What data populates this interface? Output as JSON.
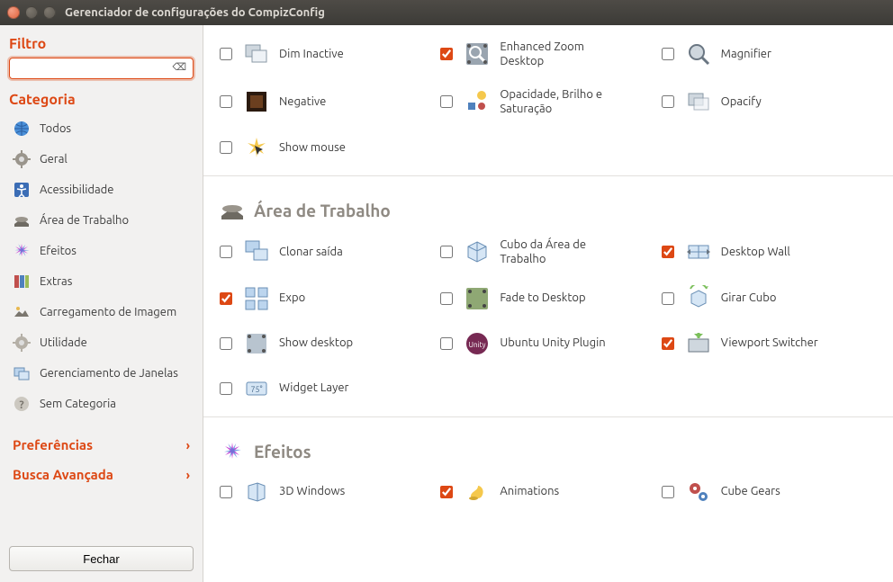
{
  "window": {
    "title": "Gerenciador de configurações do CompizConfig"
  },
  "sidebar": {
    "filter_heading": "Filtro",
    "filter_value": "",
    "filter_clear": "⌫",
    "category_heading": "Categoria",
    "categories": [
      {
        "label": "Todos",
        "icon": "globe-icon"
      },
      {
        "label": "Geral",
        "icon": "gear-icon"
      },
      {
        "label": "Acessibilidade",
        "icon": "accessibility-icon"
      },
      {
        "label": "Área de Trabalho",
        "icon": "desktop-icon"
      },
      {
        "label": "Efeitos",
        "icon": "effects-icon"
      },
      {
        "label": "Extras",
        "icon": "extras-icon"
      },
      {
        "label": "Carregamento de Imagem",
        "icon": "image-load-icon"
      },
      {
        "label": "Utilidade",
        "icon": "utility-icon"
      },
      {
        "label": "Gerenciamento de Janelas",
        "icon": "window-mgmt-icon"
      },
      {
        "label": "Sem Categoria",
        "icon": "uncategorized-icon"
      }
    ],
    "preferences": "Preferências",
    "advanced_search": "Busca Avançada",
    "close_button": "Fechar"
  },
  "sections": [
    {
      "title": null,
      "plugins": [
        {
          "label": "Dim Inactive",
          "checked": false,
          "icon": "dim-icon"
        },
        {
          "label": "Enhanced Zoom Desktop",
          "checked": true,
          "icon": "zoom-desktop-icon"
        },
        {
          "label": "Magnifier",
          "checked": false,
          "icon": "magnifier-icon"
        },
        {
          "label": "Negative",
          "checked": false,
          "icon": "negative-icon"
        },
        {
          "label": "Opacidade, Brilho e Saturação",
          "checked": false,
          "icon": "obs-icon"
        },
        {
          "label": "Opacify",
          "checked": false,
          "icon": "opacify-icon"
        },
        {
          "label": "Show mouse",
          "checked": false,
          "icon": "show-mouse-icon"
        }
      ]
    },
    {
      "title": "Área de Trabalho",
      "plugins": [
        {
          "label": "Clonar saída",
          "checked": false,
          "icon": "clone-icon"
        },
        {
          "label": "Cubo da Área de Trabalho",
          "checked": false,
          "icon": "cube-icon"
        },
        {
          "label": "Desktop Wall",
          "checked": true,
          "icon": "wall-icon"
        },
        {
          "label": "Expo",
          "checked": true,
          "icon": "expo-icon"
        },
        {
          "label": "Fade to Desktop",
          "checked": false,
          "icon": "fade-icon"
        },
        {
          "label": "Girar Cubo",
          "checked": false,
          "icon": "rotate-cube-icon"
        },
        {
          "label": "Show desktop",
          "checked": false,
          "icon": "show-desktop-icon"
        },
        {
          "label": "Ubuntu Unity Plugin",
          "checked": false,
          "icon": "unity-icon"
        },
        {
          "label": "Viewport Switcher",
          "checked": true,
          "icon": "viewport-icon"
        },
        {
          "label": "Widget Layer",
          "checked": false,
          "icon": "widget-icon"
        }
      ]
    },
    {
      "title": "Efeitos",
      "plugins": [
        {
          "label": "3D Windows",
          "checked": false,
          "icon": "3d-windows-icon"
        },
        {
          "label": "Animations",
          "checked": true,
          "icon": "animations-icon"
        },
        {
          "label": "Cube Gears",
          "checked": false,
          "icon": "cube-gears-icon"
        }
      ]
    }
  ]
}
